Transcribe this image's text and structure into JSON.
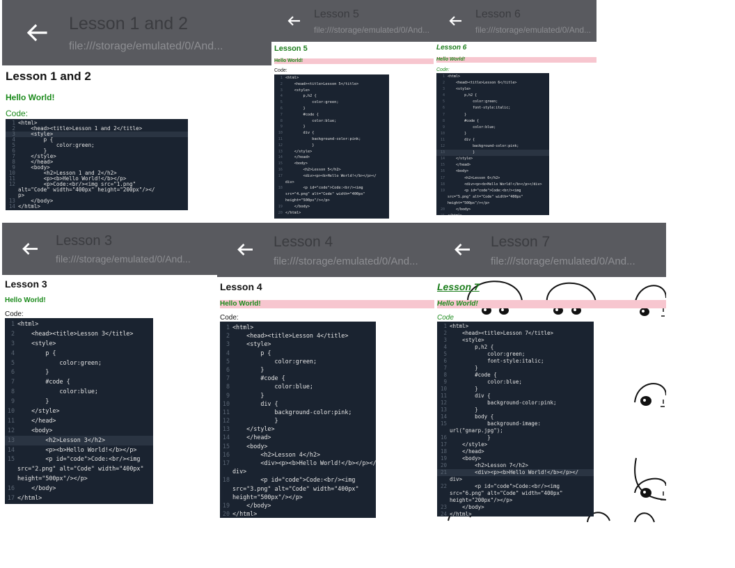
{
  "panels": [
    {
      "id": "lesson12",
      "appbar_title": "Lesson 1 and 2",
      "url": "file:///storage/emulated/0/And...",
      "heading": "Lesson 1 and 2",
      "hello": "Hello World!",
      "code_label": "Code:",
      "code_lines": [
        {
          "n": "1",
          "t": "<html>"
        },
        {
          "n": "2",
          "t": "    <head><title>Lesson 1 and 2</title>"
        },
        {
          "n": "3",
          "t": "    <style>"
        },
        {
          "n": "4",
          "t": "        p {"
        },
        {
          "n": "5",
          "t": "            color:green;"
        },
        {
          "n": "6",
          "t": "        }"
        },
        {
          "n": "7",
          "t": "    </style>"
        },
        {
          "n": "8",
          "t": "    </head>"
        },
        {
          "n": "9",
          "t": "    <body>"
        },
        {
          "n": "10",
          "t": "        <h2>Lesson 1 and 2</h2>"
        },
        {
          "n": "11",
          "t": "        <p><b>Hello World!</b></p>"
        },
        {
          "n": "12",
          "t": "        <p>Code:<br/><img src=\"1.png\""
        },
        {
          "n": "",
          "t": "alt=\"Code\" width=\"400px\" height=\"200px\"/></"
        },
        {
          "n": "",
          "t": "p>"
        },
        {
          "n": "13",
          "t": "    </body>"
        },
        {
          "n": "14",
          "t": "</html>"
        }
      ]
    },
    {
      "id": "lesson5",
      "appbar_title": "Lesson 5",
      "url": "file:///storage/emulated/0/And...",
      "heading": "Lesson 5",
      "hello": "Hello World!",
      "code_label": "Code:",
      "code_lines": [
        {
          "n": "1",
          "t": "<html>"
        },
        {
          "n": "2",
          "t": "    <head><title>Lesson 5</title>"
        },
        {
          "n": "3",
          "t": "    <style>"
        },
        {
          "n": "4",
          "t": "        p,h2 {"
        },
        {
          "n": "5",
          "t": "            color:green;"
        },
        {
          "n": "6",
          "t": "        }"
        },
        {
          "n": "7",
          "t": "        #code {"
        },
        {
          "n": "8",
          "t": "            color:blue;"
        },
        {
          "n": "9",
          "t": "        }"
        },
        {
          "n": "10",
          "t": "        div {"
        },
        {
          "n": "11",
          "t": "            background-color:pink;"
        },
        {
          "n": "12",
          "t": "            }"
        },
        {
          "n": "13",
          "t": "    </style>"
        },
        {
          "n": "14",
          "t": "    </head>"
        },
        {
          "n": "15",
          "t": "    <body>"
        },
        {
          "n": "16",
          "t": "        <h2>Lesson 5</h2>"
        },
        {
          "n": "17",
          "t": "        <div><p><b>Hello World!</b></p></"
        },
        {
          "n": "",
          "t": "div>"
        },
        {
          "n": "18",
          "t": "        <p id=\"code\">Code:<br/><img"
        },
        {
          "n": "",
          "t": "src=\"4.png\" alt=\"Code\" width=\"400px\""
        },
        {
          "n": "",
          "t": "height=\"500px\"/></p>"
        },
        {
          "n": "19",
          "t": "    </body>"
        },
        {
          "n": "20",
          "t": "</html>"
        }
      ]
    },
    {
      "id": "lesson6",
      "appbar_title": "Lesson 6",
      "url": "file:///storage/emulated/0/And...",
      "heading": "Lesson 6",
      "hello": "Hello World!",
      "code_label": "Code:",
      "code_lines": [
        {
          "n": "1",
          "t": "<html>"
        },
        {
          "n": "2",
          "t": "    <head><title>Lesson 6</title>"
        },
        {
          "n": "3",
          "t": "    <style>"
        },
        {
          "n": "4",
          "t": "        p,h2 {"
        },
        {
          "n": "5",
          "t": "            color:green;"
        },
        {
          "n": "6",
          "t": "            font-style:italic;"
        },
        {
          "n": "7",
          "t": "        }"
        },
        {
          "n": "8",
          "t": "        #code {"
        },
        {
          "n": "9",
          "t": "            color:blue;"
        },
        {
          "n": "10",
          "t": "        }"
        },
        {
          "n": "11",
          "t": "        div {"
        },
        {
          "n": "12",
          "t": "            background-color:pink;"
        },
        {
          "n": "13",
          "t": "            }"
        },
        {
          "n": "14",
          "t": "    </style>"
        },
        {
          "n": "15",
          "t": "    </head>"
        },
        {
          "n": "16",
          "t": "    <body>"
        },
        {
          "n": "17",
          "t": "        <h2>Lesson 6</h2>"
        },
        {
          "n": "18",
          "t": "        <div><p><b>Hello World!</b></p></div>"
        },
        {
          "n": "19",
          "t": "        <p id=\"code\">Code:<br/><img"
        },
        {
          "n": "",
          "t": "src=\"5.png\" alt=\"Code\" width=\"400px\""
        },
        {
          "n": "",
          "t": "height=\"500px\"/></p>"
        },
        {
          "n": "20",
          "t": "    </body>"
        },
        {
          "n": "21",
          "t": "</html>"
        }
      ]
    },
    {
      "id": "lesson3",
      "appbar_title": "Lesson 3",
      "url": "file:///storage/emulated/0/And...",
      "heading": "Lesson 3",
      "hello": "Hello World!",
      "code_label": "Code:",
      "code_lines": [
        {
          "n": "1",
          "t": "<html>"
        },
        {
          "n": "2",
          "t": "    <head><title>Lesson 3</title>"
        },
        {
          "n": "3",
          "t": "    <style>"
        },
        {
          "n": "4",
          "t": "        p {"
        },
        {
          "n": "5",
          "t": "            color:green;"
        },
        {
          "n": "6",
          "t": "        }"
        },
        {
          "n": "7",
          "t": "        #code {"
        },
        {
          "n": "8",
          "t": "            color:blue;"
        },
        {
          "n": "9",
          "t": "        }"
        },
        {
          "n": "10",
          "t": "    </style>"
        },
        {
          "n": "11",
          "t": "    </head>"
        },
        {
          "n": "12",
          "t": "    <body>"
        },
        {
          "n": "13",
          "t": "        <h2>Lesson 3</h2>"
        },
        {
          "n": "14",
          "t": "        <p><b>Hello World!</b></p>"
        },
        {
          "n": "15",
          "t": "        <p id=\"code\">Code:<br/><img"
        },
        {
          "n": "",
          "t": "src=\"2.png\" alt=\"Code\" width=\"400px\""
        },
        {
          "n": "",
          "t": "height=\"500px\"/></p>"
        },
        {
          "n": "16",
          "t": "    </body>"
        },
        {
          "n": "17",
          "t": "</html>"
        }
      ]
    },
    {
      "id": "lesson4",
      "appbar_title": "Lesson 4",
      "url": "file:///storage/emulated/0/And...",
      "heading": "Lesson 4",
      "hello": "Hello World!",
      "code_label": "Code:",
      "code_lines": [
        {
          "n": "1",
          "t": "<html>"
        },
        {
          "n": "2",
          "t": "    <head><title>Lesson 4</title>"
        },
        {
          "n": "3",
          "t": "    <style>"
        },
        {
          "n": "4",
          "t": "        p {"
        },
        {
          "n": "5",
          "t": "            color:green;"
        },
        {
          "n": "6",
          "t": "        }"
        },
        {
          "n": "7",
          "t": "        #code {"
        },
        {
          "n": "8",
          "t": "            color:blue;"
        },
        {
          "n": "9",
          "t": "        }"
        },
        {
          "n": "10",
          "t": "        div {"
        },
        {
          "n": "11",
          "t": "            background-color:pink;"
        },
        {
          "n": "12",
          "t": "            }"
        },
        {
          "n": "13",
          "t": "    </style>"
        },
        {
          "n": "14",
          "t": "    </head>"
        },
        {
          "n": "15",
          "t": "    <body>"
        },
        {
          "n": "16",
          "t": "        <h2>Lesson 4</h2>"
        },
        {
          "n": "17",
          "t": "        <div><p><b>Hello World!</b></p></"
        },
        {
          "n": "",
          "t": "div>"
        },
        {
          "n": "18",
          "t": "        <p id=\"code\">Code:<br/><img"
        },
        {
          "n": "",
          "t": "src=\"3.png\" alt=\"Code\" width=\"400px\""
        },
        {
          "n": "",
          "t": "height=\"500px\"/></p>"
        },
        {
          "n": "19",
          "t": "    </body>"
        },
        {
          "n": "20",
          "t": "</html>"
        }
      ]
    },
    {
      "id": "lesson7",
      "appbar_title": "Lesson 7",
      "url": "file:///storage/emulated/0/And...",
      "heading": "Lesson 7",
      "hello": "Hello World!",
      "code_label": "Code",
      "code_lines": [
        {
          "n": "1",
          "t": "<html>"
        },
        {
          "n": "2",
          "t": "    <head><title>Lesson 7</title>"
        },
        {
          "n": "3",
          "t": "    <style>"
        },
        {
          "n": "4",
          "t": "        p,h2 {"
        },
        {
          "n": "5",
          "t": "            color:green;"
        },
        {
          "n": "6",
          "t": "            font-style:italic;"
        },
        {
          "n": "7",
          "t": "        }"
        },
        {
          "n": "8",
          "t": "        #code {"
        },
        {
          "n": "9",
          "t": "            color:blue;"
        },
        {
          "n": "10",
          "t": "        }"
        },
        {
          "n": "11",
          "t": "        div {"
        },
        {
          "n": "12",
          "t": "            background-color:pink;"
        },
        {
          "n": "13",
          "t": "        }"
        },
        {
          "n": "14",
          "t": "        body {"
        },
        {
          "n": "15",
          "t": "            background-image:"
        },
        {
          "n": "",
          "t": "url(\"gnarp.jpg\");"
        },
        {
          "n": "16",
          "t": "            }"
        },
        {
          "n": "17",
          "t": "    </style>"
        },
        {
          "n": "18",
          "t": "    </head>"
        },
        {
          "n": "19",
          "t": "    <body>"
        },
        {
          "n": "20",
          "t": "        <h2>Lesson 7</h2>"
        },
        {
          "n": "21",
          "t": "        <div><p><b>Hello World!</b></p></"
        },
        {
          "n": "",
          "t": "div>"
        },
        {
          "n": "22",
          "t": "        <p id=\"code\">Code:<br/><img"
        },
        {
          "n": "",
          "t": "src=\"6.png\" alt=\"Code\" width=\"400px\""
        },
        {
          "n": "",
          "t": "height=\"200px\"/></p>"
        },
        {
          "n": "23",
          "t": "    </body>"
        },
        {
          "n": "24",
          "t": "</html>"
        }
      ]
    }
  ],
  "colors": {
    "appbar": "#595a5f",
    "green_text": "#1b8a1b",
    "pink": "#f7c6cf",
    "code_bg": "#1a2330"
  }
}
